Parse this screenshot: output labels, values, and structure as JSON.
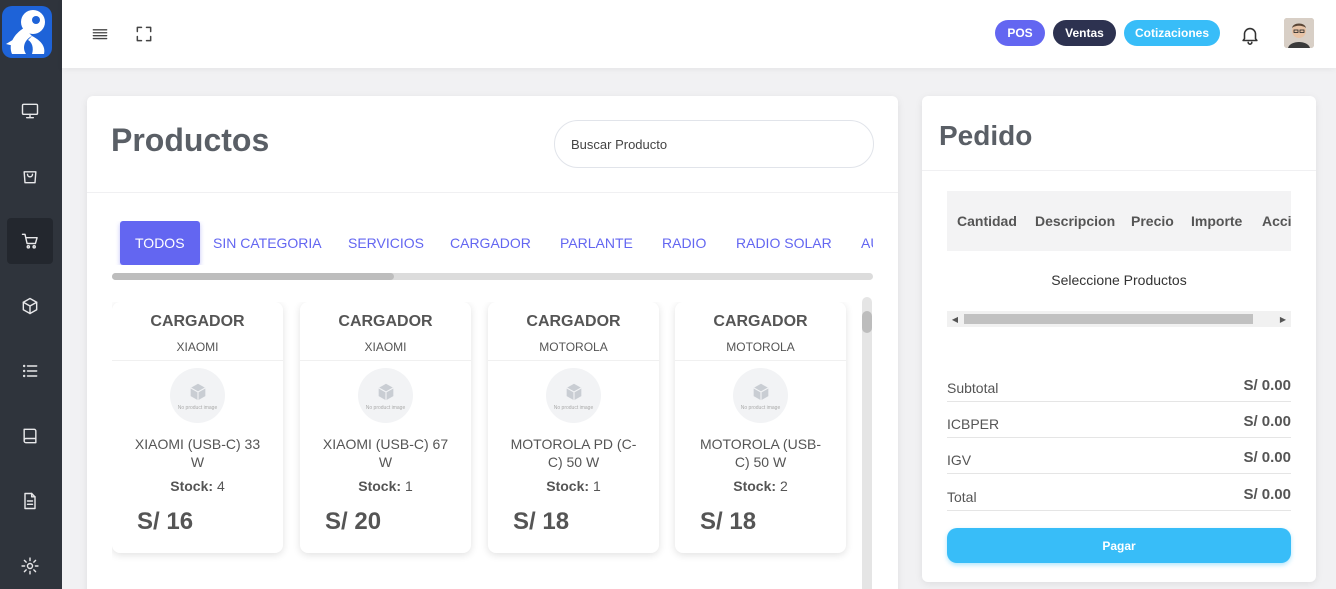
{
  "header": {
    "menu_icon": "hamburger-icon",
    "fullscreen_icon": "fullscreen-icon",
    "buttons": {
      "pos": "POS",
      "ventas": "Ventas",
      "cotizaciones": "Cotizaciones"
    },
    "colors": {
      "pos": "#6366f1",
      "ventas": "#2d3250",
      "cotizaciones": "#38bdf8"
    }
  },
  "sidebar": {
    "items": [
      {
        "icon": "monitor-icon"
      },
      {
        "icon": "shopping-bag-icon"
      },
      {
        "icon": "cart-icon",
        "active": true
      },
      {
        "icon": "box-icon"
      },
      {
        "icon": "list-icon"
      },
      {
        "icon": "book-icon"
      },
      {
        "icon": "document-icon"
      },
      {
        "icon": "gear-icon"
      }
    ]
  },
  "products": {
    "title": "Productos",
    "search_placeholder": "Buscar Producto",
    "categories": [
      "TODOS",
      "SIN CATEGORIA",
      "SERVICIOS",
      "CARGADOR",
      "PARLANTE",
      "RADIO",
      "RADIO SOLAR",
      "AU"
    ],
    "no_image_text": "No product image",
    "stock_label": "Stock:",
    "items": [
      {
        "category": "CARGADOR",
        "brand": "XIAOMI",
        "name": "XIAOMI (USB-C) 33 W",
        "stock": "4",
        "price": "S/ 16"
      },
      {
        "category": "CARGADOR",
        "brand": "XIAOMI",
        "name": "XIAOMI (USB-C) 67 W",
        "stock": "1",
        "price": "S/ 20"
      },
      {
        "category": "CARGADOR",
        "brand": "MOTOROLA",
        "name": "MOTOROLA PD (C-C) 50 W",
        "stock": "1",
        "price": "S/ 18"
      },
      {
        "category": "CARGADOR",
        "brand": "MOTOROLA",
        "name": "MOTOROLA (USB-C) 50 W",
        "stock": "2",
        "price": "S/ 18"
      }
    ]
  },
  "order": {
    "title": "Pedido",
    "columns": [
      "Cantidad",
      "Descripcion",
      "Precio",
      "Importe",
      "Acci"
    ],
    "empty_message": "Seleccione Productos",
    "totals": [
      {
        "label": "Subtotal",
        "value": "S/ 0.00"
      },
      {
        "label": "ICBPER",
        "value": "S/ 0.00"
      },
      {
        "label": "IGV",
        "value": "S/ 0.00"
      },
      {
        "label": "Total",
        "value": "S/ 0.00"
      }
    ],
    "pay_button": "Pagar"
  }
}
